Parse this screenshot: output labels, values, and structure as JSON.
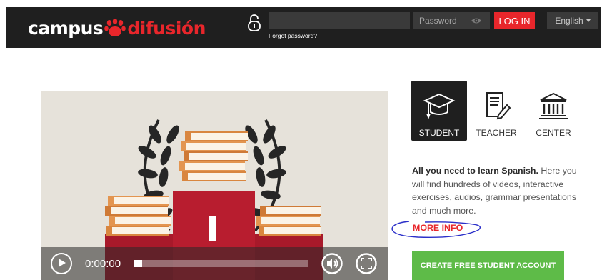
{
  "header": {
    "logo_word1": "campus",
    "logo_word2": "difusión",
    "password_placeholder": "Password",
    "forgot_label": "Forgot password?",
    "login_label": "LOG IN",
    "language_label": "English"
  },
  "video": {
    "time": "0:00:00",
    "progress": 0
  },
  "tabs": [
    {
      "label": "STUDENT",
      "active": true
    },
    {
      "label": "TEACHER",
      "active": false
    },
    {
      "label": "CENTER",
      "active": false
    }
  ],
  "description": {
    "bold": "All you need to learn Spanish.",
    "rest": " Here you will find hundreds of videos, interactive exercises, audios, grammar presentations and much more."
  },
  "more_info_label": "MORE INFO",
  "cta_label": "CREATE FREE STUDENT ACCOUNT",
  "colors": {
    "brand_red": "#e8262b",
    "header_bg": "#1f1f1f",
    "cta_green": "#5ebb48"
  }
}
